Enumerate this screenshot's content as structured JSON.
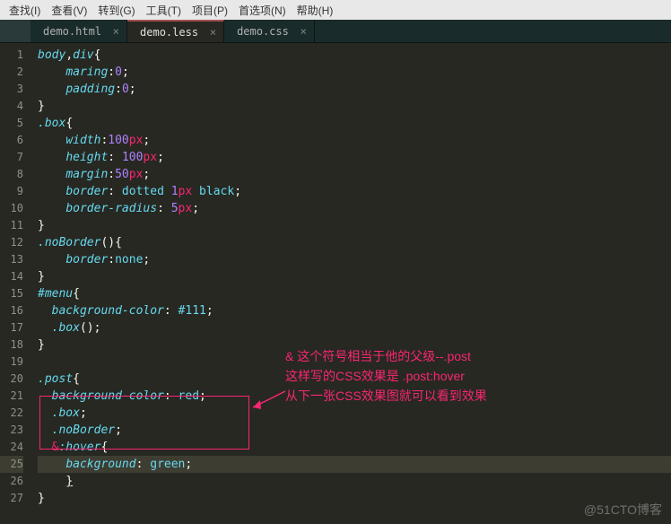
{
  "menu": {
    "items": [
      "查找(I)",
      "查看(V)",
      "转到(G)",
      "工具(T)",
      "项目(P)",
      "首选项(N)",
      "帮助(H)"
    ]
  },
  "tabs": {
    "items": [
      {
        "label": "demo.html",
        "active": false
      },
      {
        "label": "demo.less",
        "active": true
      },
      {
        "label": "demo.css",
        "active": false
      }
    ]
  },
  "gutter": {
    "start": 1,
    "end": 27,
    "current": 25
  },
  "annotation": {
    "l1": "& 这个符号相当于他的父级--.post",
    "l2": "这样写的CSS效果是  .post:hover",
    "l3": "从下一张CSS效果图就可以看到效果"
  },
  "watermark": "@51CTO博客",
  "code": {
    "l1": {
      "sel1": "body",
      "comma": ",",
      "sel2": "div",
      "brace": "{"
    },
    "l2": {
      "p": "maring",
      "v": "0"
    },
    "l3": {
      "p": "padding",
      "v": "0"
    },
    "l4": {
      "brace": "}"
    },
    "l5": {
      "sel": ".box",
      "brace": "{"
    },
    "l6": {
      "p": "width",
      "n": "100",
      "u": "px"
    },
    "l7": {
      "p": "height",
      "sp": " ",
      "n": "100",
      "u": "px"
    },
    "l8": {
      "p": "margin",
      "n": "50",
      "u": "px"
    },
    "l9": {
      "p": "border",
      "v": " dotted ",
      "n": "1",
      "u": "px",
      "v2": " black"
    },
    "l10": {
      "p": "border-radius",
      "sp": " ",
      "n": "5",
      "u": "px"
    },
    "l11": {
      "brace": "}"
    },
    "l12": {
      "sel": ".noBorder",
      "paren": "()",
      "brace": "{"
    },
    "l13": {
      "p": "border",
      "v": "none"
    },
    "l14": {
      "brace": "}"
    },
    "l15": {
      "sel": "#menu",
      "brace": "{"
    },
    "l16": {
      "p": "background-color",
      "sp": " ",
      "v": "#111"
    },
    "l17": {
      "sel": ".box",
      "paren": "()"
    },
    "l18": {
      "brace": "}"
    },
    "l20": {
      "sel": ".post",
      "brace": "{"
    },
    "l21": {
      "p": "background-color",
      "sp": " ",
      "v": "red"
    },
    "l22": {
      "sel": ".box"
    },
    "l23": {
      "sel": ".noBorder"
    },
    "l24": {
      "amp": "&",
      "pseudo": ":hover",
      "brace": "{"
    },
    "l25": {
      "p": "background",
      "sp": " ",
      "v": "green"
    },
    "l26": {
      "brace": "}"
    },
    "l27": {
      "brace": "}"
    }
  }
}
